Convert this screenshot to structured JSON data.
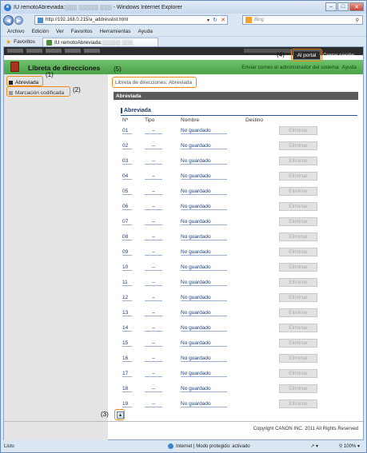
{
  "window": {
    "title": "IU remotoAbreviada:░░░ ░░░░░ ░░░ - Windows Internet Explorer",
    "controls": [
      "–",
      "□",
      "✕"
    ]
  },
  "browser": {
    "url": "http://192.168.0.215/a_addresslist.html",
    "search_placeholder": "Bing",
    "menu": [
      "Archivo",
      "Edición",
      "Ver",
      "Favoritos",
      "Herramientas",
      "Ayuda"
    ],
    "favorites_label": "Favoritos",
    "tab_title": "IU remotoAbreviada:░░░░░ ░░░",
    "status_left": "Listo",
    "status_zone": "Internet | Modo protegido: activado",
    "status_zoom": "100%"
  },
  "header": {
    "portal_button": "Al portal",
    "logout": "Cerrar sesión",
    "app_title": "Libreta de direcciones",
    "link_email": "Enviar correo al administrador del sistema",
    "link_help": "Ayuda"
  },
  "sidebar": {
    "items": [
      {
        "label": "Abreviada"
      },
      {
        "label": "Marcación codificada"
      }
    ]
  },
  "main": {
    "breadcrumb": "Libreta de direcciones: Abreviada",
    "section_bar": "Abreviada",
    "subheading": "Abreviada",
    "columns": [
      "Nº",
      "Tipo",
      "Nombre",
      "Destino"
    ],
    "rows": [
      {
        "num": "01",
        "type": "–",
        "name": "No guardado",
        "action": "Eliminar"
      },
      {
        "num": "02",
        "type": "–",
        "name": "No guardado",
        "action": "Eliminar"
      },
      {
        "num": "03",
        "type": "–",
        "name": "No guardado",
        "action": "Eliminar"
      },
      {
        "num": "04",
        "type": "–",
        "name": "No guardado",
        "action": "Eliminar"
      },
      {
        "num": "05",
        "type": "–",
        "name": "No guardado",
        "action": "Eliminar"
      },
      {
        "num": "06",
        "type": "–",
        "name": "No guardado",
        "action": "Eliminar"
      },
      {
        "num": "07",
        "type": "–",
        "name": "No guardado",
        "action": "Eliminar"
      },
      {
        "num": "08",
        "type": "–",
        "name": "No guardado",
        "action": "Eliminar"
      },
      {
        "num": "09",
        "type": "–",
        "name": "No guardado",
        "action": "Eliminar"
      },
      {
        "num": "10",
        "type": "–",
        "name": "No guardado",
        "action": "Eliminar"
      },
      {
        "num": "11",
        "type": "–",
        "name": "No guardado",
        "action": "Eliminar"
      },
      {
        "num": "12",
        "type": "–",
        "name": "No guardado",
        "action": "Eliminar"
      },
      {
        "num": "13",
        "type": "–",
        "name": "No guardado",
        "action": "Eliminar"
      },
      {
        "num": "14",
        "type": "–",
        "name": "No guardado",
        "action": "Eliminar"
      },
      {
        "num": "15",
        "type": "–",
        "name": "No guardado",
        "action": "Eliminar"
      },
      {
        "num": "16",
        "type": "–",
        "name": "No guardado",
        "action": "Eliminar"
      },
      {
        "num": "17",
        "type": "–",
        "name": "No guardado",
        "action": "Eliminar"
      },
      {
        "num": "18",
        "type": "–",
        "name": "No guardado",
        "action": "Eliminar"
      },
      {
        "num": "19",
        "type": "–",
        "name": "No guardado",
        "action": "Eliminar"
      }
    ],
    "copyright": "Copyright CANON INC. 2011 All Rights Reserved"
  },
  "annotations": [
    "(1)",
    "(2)",
    "(3)",
    "(4)",
    "(5)"
  ],
  "colors": {
    "accent_green": "#4ca348",
    "annotation_orange": "#f08b1b",
    "header_dark": "#2d2d2d"
  }
}
